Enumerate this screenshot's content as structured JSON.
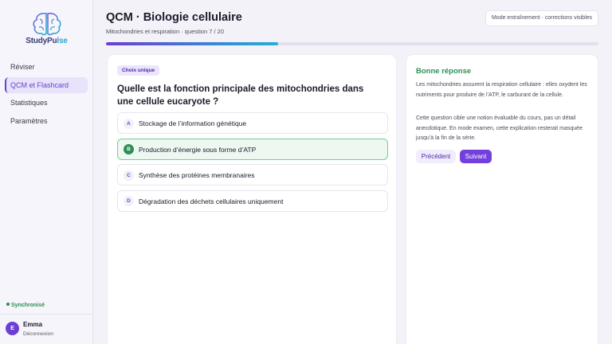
{
  "app": {
    "brand_part1": "StudyPu",
    "brand_part2": "lse",
    "logo_icon": "brain-icon"
  },
  "sidebar": {
    "items": [
      {
        "label": "Réviser",
        "active": false
      },
      {
        "label": "QCM et Flashcard",
        "active": true
      },
      {
        "label": "Statistiques",
        "active": false
      },
      {
        "label": "Paramètres",
        "active": false
      }
    ],
    "sync_status": "Synchronisé",
    "user": {
      "initial": "E",
      "name": "Emma",
      "logout_label": "Déconnexion"
    }
  },
  "header": {
    "title": "QCM · Biologie cellulaire",
    "subtitle": "Mitochondries et respiration · question 7 / 20",
    "mode": "Mode entraînement · corrections visibles",
    "progress": 0.35
  },
  "question": {
    "type_label": "Choix unique",
    "text": "Quelle est la fonction principale des mitochondries dans une cellule eucaryote ?",
    "options": [
      {
        "letter": "A",
        "text": "Stockage de l’information génétique",
        "correct": false
      },
      {
        "letter": "B",
        "text": "Production d’énergie sous forme d’ATP",
        "correct": true
      },
      {
        "letter": "C",
        "text": "Synthèse des protéines membranaires",
        "correct": false
      },
      {
        "letter": "D",
        "text": "Dégradation des déchets cellulaires uniquement",
        "correct": false
      }
    ]
  },
  "feedback": {
    "title": "Bonne réponse",
    "paragraph1": "Les mitochondries assurent la respiration cellulaire : elles oxydent les nutriments pour produire de l’ATP, le carburant de la cellule.",
    "paragraph2": "Cette question cible une notion évaluable du cours, pas un détail anecdotique. En mode examen, cette explication resterait masquée jusqu’à la fin de la série.",
    "prev_label": "Précédent",
    "next_label": "Suivant"
  },
  "colors": {
    "accent": "#6a3fd3",
    "correct": "#2e8f56",
    "sync": "#2f8d4e",
    "progress_end": "#23b0d3"
  }
}
